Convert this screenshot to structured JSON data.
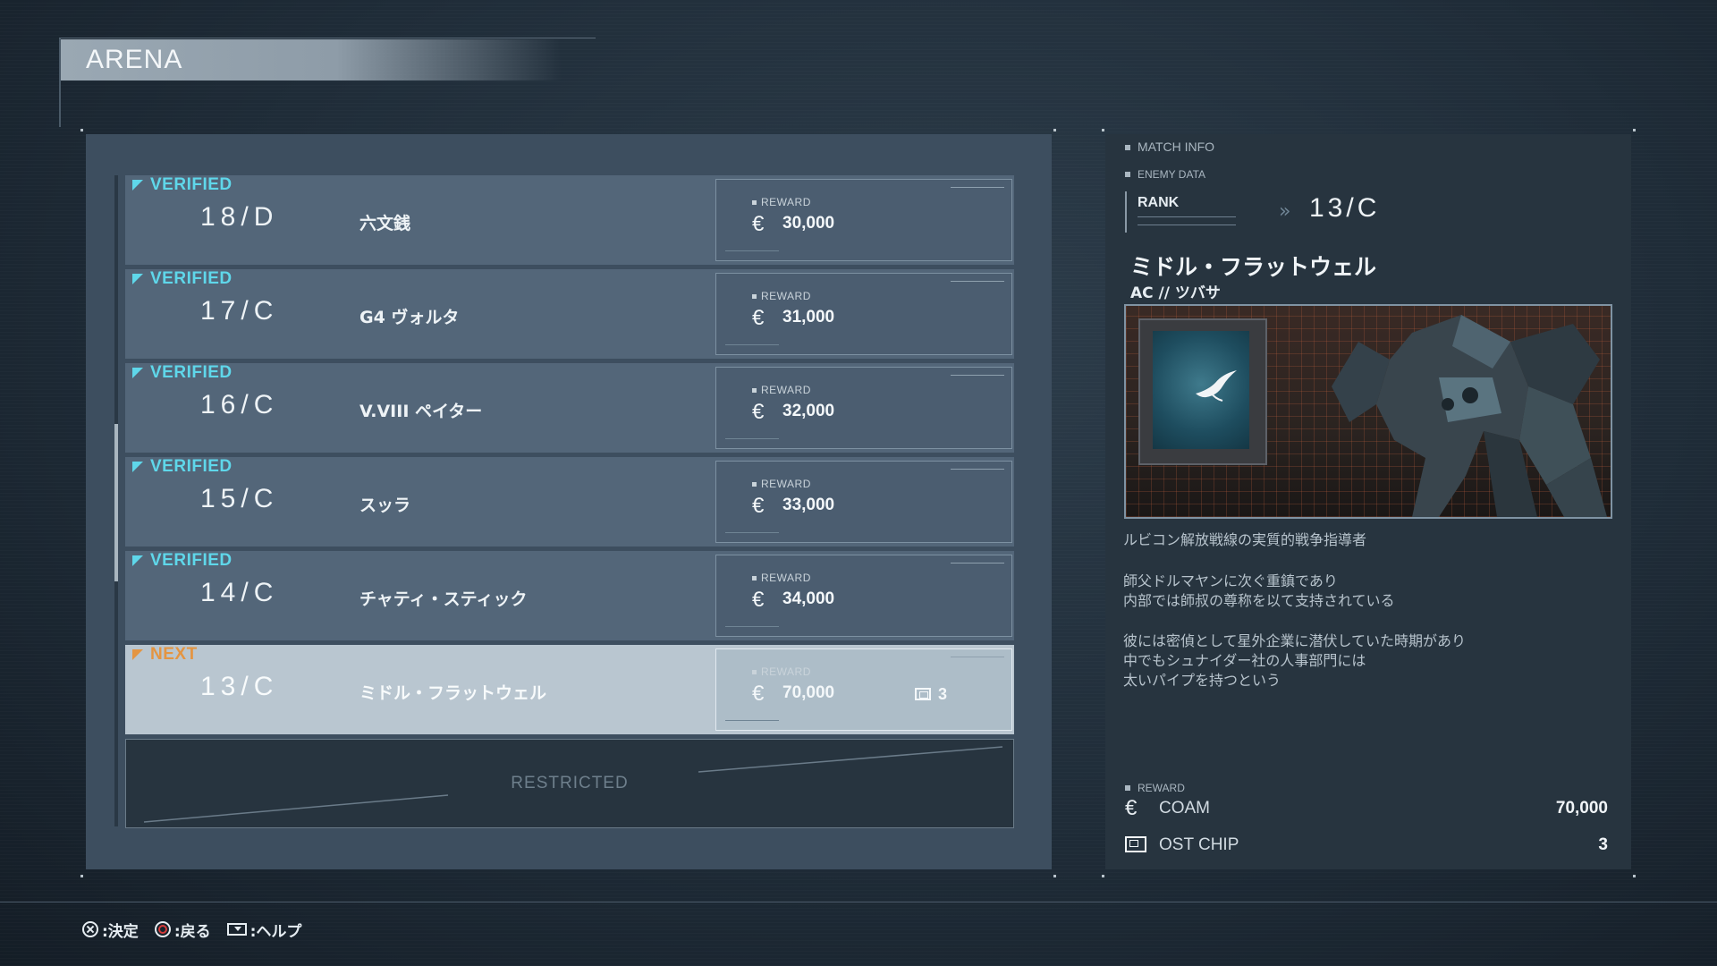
{
  "screen": {
    "title": "ARENA"
  },
  "matches": [
    {
      "status": "VERIFIED",
      "rank": "18/D",
      "name": "六文銭",
      "reward_label": "REWARD",
      "currency_symbol": "€",
      "reward": "30,000",
      "chip": null
    },
    {
      "status": "VERIFIED",
      "rank": "17/C",
      "name": "G4 ヴォルタ",
      "reward_label": "REWARD",
      "currency_symbol": "€",
      "reward": "31,000",
      "chip": null
    },
    {
      "status": "VERIFIED",
      "rank": "16/C",
      "name": "V.VIII ペイター",
      "reward_label": "REWARD",
      "currency_symbol": "€",
      "reward": "32,000",
      "chip": null
    },
    {
      "status": "VERIFIED",
      "rank": "15/C",
      "name": "スッラ",
      "reward_label": "REWARD",
      "currency_symbol": "€",
      "reward": "33,000",
      "chip": null
    },
    {
      "status": "VERIFIED",
      "rank": "14/C",
      "name": "チャティ・スティック",
      "reward_label": "REWARD",
      "currency_symbol": "€",
      "reward": "34,000",
      "chip": null
    },
    {
      "status": "NEXT",
      "rank": "13/C",
      "name": "ミドル・フラットウェル",
      "reward_label": "REWARD",
      "currency_symbol": "€",
      "reward": "70,000",
      "chip": "3"
    }
  ],
  "restricted_label": "RESTRICTED",
  "match_info": {
    "header": "MATCH INFO",
    "enemy_data_label": "ENEMY DATA",
    "rank_label": "RANK",
    "rank_value": "13/C",
    "enemy_name": "ミドル・フラットウェル",
    "ac_name": "AC // ツバサ",
    "description": [
      "ルビコン解放戦線の実質的戦争指導者",
      "師父ドルマヤンに次ぐ重鎮であり",
      "内部では師叔の尊称を以て支持されている",
      "彼には密偵として星外企業に潜伏していた時期があり",
      "中でもシュナイダー社の人事部門には",
      "太いパイプを持つという"
    ],
    "reward_header": "REWARD",
    "rewards": [
      {
        "icon": "coam-currency-icon",
        "symbol": "€",
        "label": "COAM",
        "value": "70,000"
      },
      {
        "icon": "ost-chip-icon",
        "label": "OST CHIP",
        "value": "3"
      }
    ]
  },
  "footer": {
    "confirm": ":決定",
    "back": ":戻る",
    "help": ":ヘルプ"
  },
  "colors": {
    "verified": "#5fd7ea",
    "next": "#e49542",
    "selected_row": "#b9c6d0",
    "row": "#536679"
  }
}
